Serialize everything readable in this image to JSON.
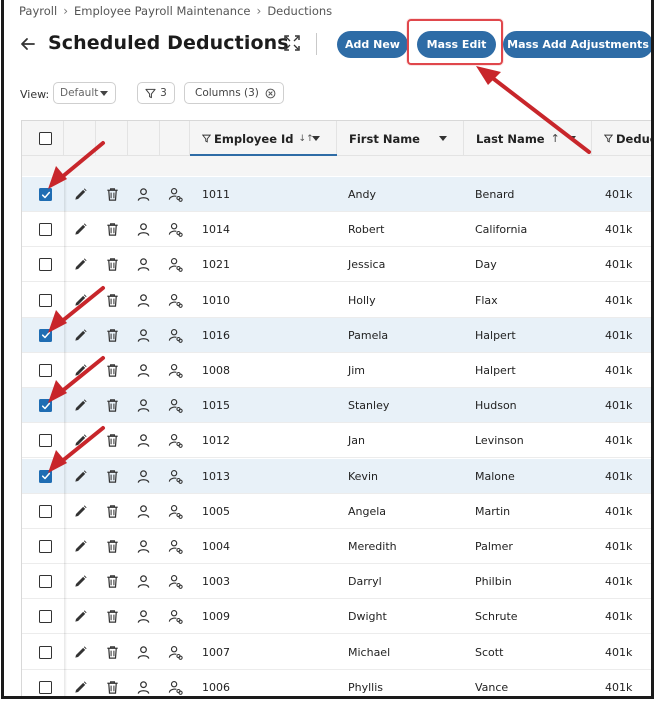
{
  "breadcrumb": {
    "items": [
      "Payroll",
      "Employee Payroll Maintenance",
      "Deductions"
    ]
  },
  "header": {
    "title": "Scheduled Deductions",
    "buttons": {
      "add_new": "Add New",
      "mass_edit": "Mass Edit",
      "mass_add_adjustments": "Mass Add Adjustments"
    },
    "accent_color": "#2e6ca6",
    "highlight_color": "#e0474c"
  },
  "toolbar": {
    "view_label": "View:",
    "view_value": "Default",
    "filter_count": "3",
    "columns_label": "Columns (3)"
  },
  "grid": {
    "columns": [
      "Employee Id",
      "First Name",
      "Last Name",
      "Deduction"
    ],
    "sort": {
      "employee_id": "desc",
      "last_name": "asc"
    },
    "rows": [
      {
        "checked": true,
        "employee_id": "1011",
        "first_name": "Andy",
        "last_name": "Benard",
        "deduction": "401k"
      },
      {
        "checked": false,
        "employee_id": "1014",
        "first_name": "Robert",
        "last_name": "California",
        "deduction": "401k"
      },
      {
        "checked": false,
        "employee_id": "1021",
        "first_name": "Jessica",
        "last_name": "Day",
        "deduction": "401k"
      },
      {
        "checked": false,
        "employee_id": "1010",
        "first_name": "Holly",
        "last_name": "Flax",
        "deduction": "401k"
      },
      {
        "checked": true,
        "employee_id": "1016",
        "first_name": "Pamela",
        "last_name": "Halpert",
        "deduction": "401k"
      },
      {
        "checked": false,
        "employee_id": "1008",
        "first_name": "Jim",
        "last_name": "Halpert",
        "deduction": "401k"
      },
      {
        "checked": true,
        "employee_id": "1015",
        "first_name": "Stanley",
        "last_name": "Hudson",
        "deduction": "401k"
      },
      {
        "checked": false,
        "employee_id": "1012",
        "first_name": "Jan",
        "last_name": "Levinson",
        "deduction": "401k"
      },
      {
        "checked": true,
        "employee_id": "1013",
        "first_name": "Kevin",
        "last_name": "Malone",
        "deduction": "401k"
      },
      {
        "checked": false,
        "employee_id": "1005",
        "first_name": "Angela",
        "last_name": "Martin",
        "deduction": "401k"
      },
      {
        "checked": false,
        "employee_id": "1004",
        "first_name": "Meredith",
        "last_name": "Palmer",
        "deduction": "401k"
      },
      {
        "checked": false,
        "employee_id": "1003",
        "first_name": "Darryl",
        "last_name": "Philbin",
        "deduction": "401k"
      },
      {
        "checked": false,
        "employee_id": "1009",
        "first_name": "Dwight",
        "last_name": "Schrute",
        "deduction": "401k"
      },
      {
        "checked": false,
        "employee_id": "1007",
        "first_name": "Michael",
        "last_name": "Scott",
        "deduction": "401k"
      },
      {
        "checked": false,
        "employee_id": "1006",
        "first_name": "Phyllis",
        "last_name": "Vance",
        "deduction": "401k"
      }
    ],
    "selected_row_color": "#e8f1f8"
  }
}
